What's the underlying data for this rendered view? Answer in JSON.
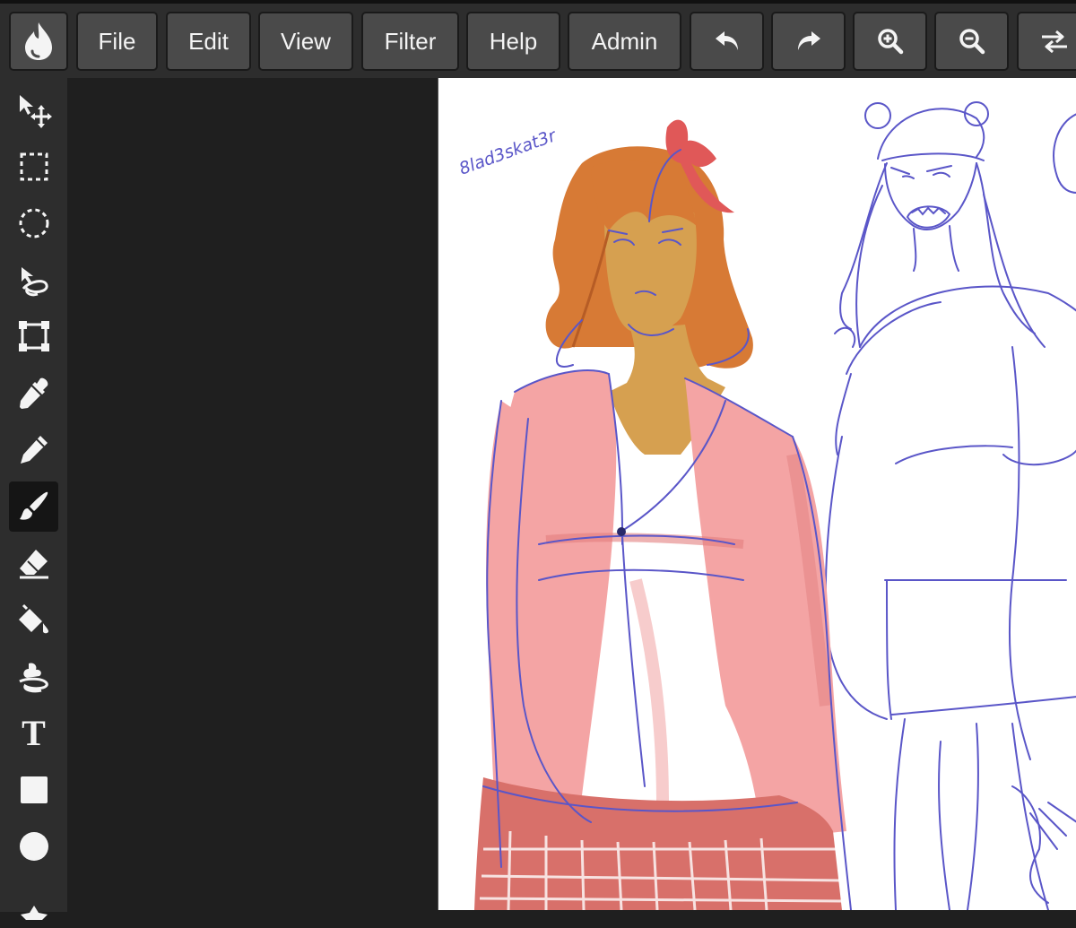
{
  "menu": {
    "file": "File",
    "edit": "Edit",
    "view": "View",
    "filter": "Filter",
    "help": "Help",
    "admin": "Admin"
  },
  "toolbar_icons": [
    "app-logo-icon",
    "undo-icon",
    "redo-icon",
    "zoom-in-icon",
    "zoom-out-icon",
    "swap-icon"
  ],
  "tools": [
    {
      "name": "move-tool",
      "icon": "move-icon"
    },
    {
      "name": "rect-select-tool",
      "icon": "rect-select-icon"
    },
    {
      "name": "ellipse-select-tool",
      "icon": "ellipse-select-icon"
    },
    {
      "name": "lasso-tool",
      "icon": "lasso-icon"
    },
    {
      "name": "transform-tool",
      "icon": "transform-icon"
    },
    {
      "name": "eyedropper-tool",
      "icon": "eyedropper-icon"
    },
    {
      "name": "pencil-tool",
      "icon": "pencil-icon"
    },
    {
      "name": "brush-tool",
      "icon": "brush-icon",
      "active": true
    },
    {
      "name": "eraser-tool",
      "icon": "eraser-icon"
    },
    {
      "name": "bucket-tool",
      "icon": "paint-bucket-icon"
    },
    {
      "name": "smudge-tool",
      "icon": "smudge-icon"
    },
    {
      "name": "text-tool",
      "icon": "text-icon"
    },
    {
      "name": "rectangle-tool",
      "icon": "rectangle-icon"
    },
    {
      "name": "ellipse-tool",
      "icon": "ellipse-icon"
    },
    {
      "name": "star-tool",
      "icon": "star-icon"
    }
  ],
  "text_tool_glyph": "T",
  "canvas": {
    "signature": "8lad3skat3r"
  },
  "colors": {
    "ui_dark": "#1f1f1f",
    "ui_panel": "#2d2d2d",
    "button": "#4a4a4a",
    "line_art": "#5a56c8",
    "hair": "#d77a35",
    "skin": "#d6a050",
    "jacket": "#f4a4a4",
    "skirt": "#d8706a",
    "bow": "#e05858"
  }
}
